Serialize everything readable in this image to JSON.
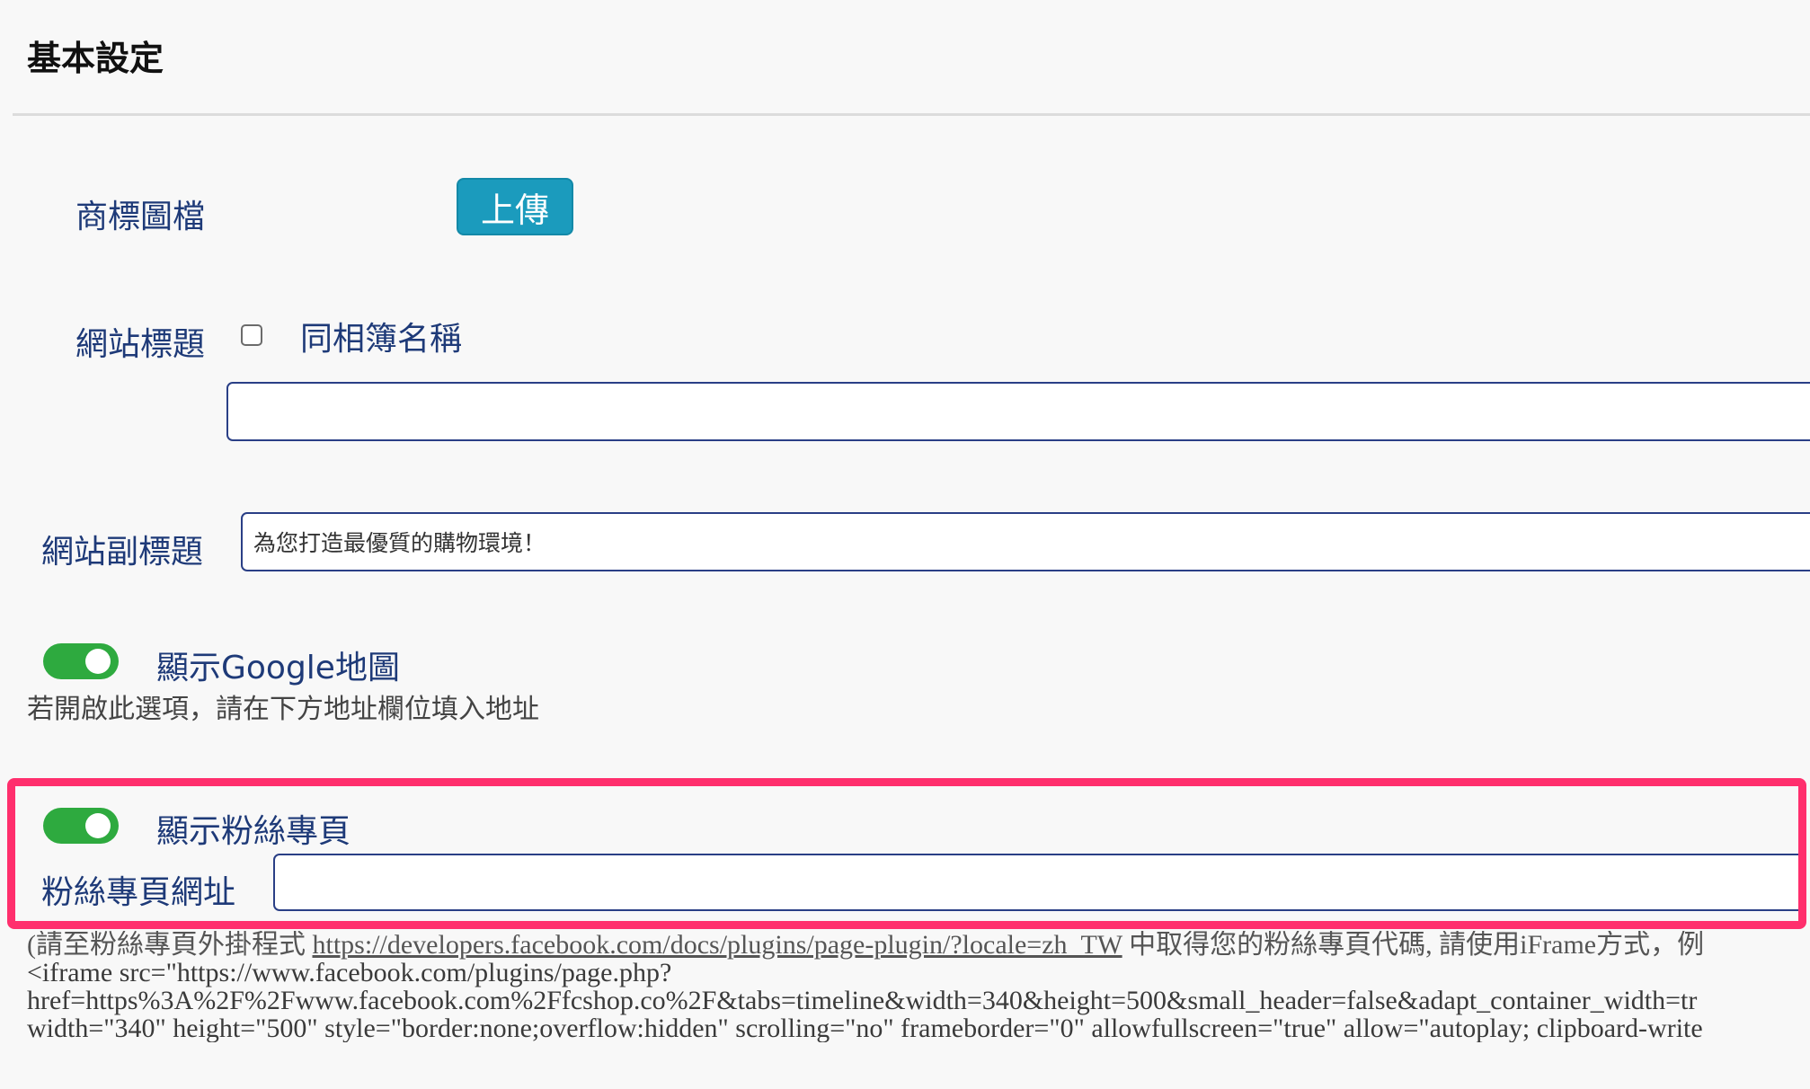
{
  "section": {
    "title": "基本設定"
  },
  "logo": {
    "label": "商標圖檔",
    "upload_button": "上傳"
  },
  "site_title": {
    "label": "網站標題",
    "same_as_album_label": "同相簿名稱",
    "same_as_album_checked": false,
    "value": ""
  },
  "site_subtitle": {
    "label": "網站副標題",
    "value": "為您打造最優質的購物環境！"
  },
  "google_map": {
    "toggle_on": true,
    "label": "顯示Google地圖",
    "helper": "若開啟此選項，請在下方地址欄位填入地址"
  },
  "fan_page": {
    "toggle_on": true,
    "label": "顯示粉絲專頁",
    "url_label": "粉絲專頁網址",
    "url_value": ""
  },
  "instructions": {
    "prefix": "(請至粉絲專頁外掛程式 ",
    "link": "https://developers.facebook.com/docs/plugins/page-plugin/?locale=zh_TW",
    "suffix": " 中取得您的粉絲專頁代碼, 請使用iFrame方式，例",
    "line2": "<iframe src=\"https://www.facebook.com/plugins/page.php?",
    "line3": "href=https%3A%2F%2Fwww.facebook.com%2Ffcshop.co%2F&tabs=timeline&width=340&height=500&small_header=false&adapt_container_width=tr",
    "line4": "width=\"340\" height=\"500\" style=\"border:none;overflow:hidden\" scrolling=\"no\" frameborder=\"0\" allowfullscreen=\"true\" allow=\"autoplay; clipboard-write"
  },
  "colors": {
    "accent": "#1b9bbd",
    "toggle_on": "#2eaa3f",
    "highlight": "#ff2f6d",
    "label": "#1e3a78"
  }
}
